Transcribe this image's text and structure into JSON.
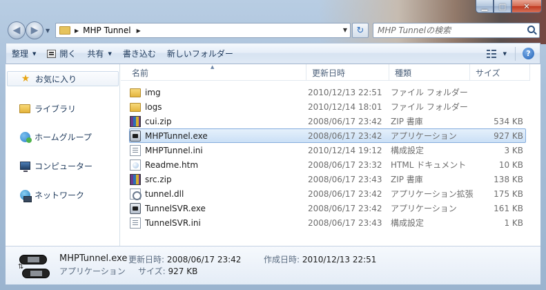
{
  "window": {
    "address_path": "MHP Tunnel",
    "search_placeholder": "MHP Tunnelの検索"
  },
  "toolbar": {
    "organize": "整理",
    "open": "開く",
    "share": "共有",
    "burn": "書き込む",
    "new_folder": "新しいフォルダー"
  },
  "nav": {
    "favorites": "お気に入り",
    "libraries": "ライブラリ",
    "homegroup": "ホームグループ",
    "computer": "コンピューター",
    "network": "ネットワーク"
  },
  "columns": {
    "name": "名前",
    "date": "更新日時",
    "type": "種類",
    "size": "サイズ"
  },
  "files": [
    {
      "name": "img",
      "date": "2010/12/13 22:51",
      "type": "ファイル フォルダー",
      "size": "",
      "icon": "folder"
    },
    {
      "name": "logs",
      "date": "2010/12/14 18:01",
      "type": "ファイル フォルダー",
      "size": "",
      "icon": "folder"
    },
    {
      "name": "cui.zip",
      "date": "2008/06/17 23:42",
      "type": "ZIP 書庫",
      "size": "534 KB",
      "icon": "zip"
    },
    {
      "name": "MHPTunnel.exe",
      "date": "2008/06/17 23:42",
      "type": "アプリケーション",
      "size": "927 KB",
      "icon": "exe"
    },
    {
      "name": "MHPTunnel.ini",
      "date": "2010/12/14 19:12",
      "type": "構成設定",
      "size": "3 KB",
      "icon": "ini"
    },
    {
      "name": "Readme.htm",
      "date": "2008/06/17 23:32",
      "type": "HTML ドキュメント",
      "size": "10 KB",
      "icon": "htm"
    },
    {
      "name": "src.zip",
      "date": "2008/06/17 23:43",
      "type": "ZIP 書庫",
      "size": "138 KB",
      "icon": "zip"
    },
    {
      "name": "tunnel.dll",
      "date": "2008/06/17 23:42",
      "type": "アプリケーション拡張",
      "size": "175 KB",
      "icon": "dll"
    },
    {
      "name": "TunnelSVR.exe",
      "date": "2008/06/17 23:42",
      "type": "アプリケーション",
      "size": "161 KB",
      "icon": "exe"
    },
    {
      "name": "TunnelSVR.ini",
      "date": "2008/06/17 23:43",
      "type": "構成設定",
      "size": "1 KB",
      "icon": "ini"
    }
  ],
  "selected_index": 3,
  "details": {
    "name": "MHPTunnel.exe",
    "type": "アプリケーション",
    "modified_label": "更新日時:",
    "modified_value": "2008/06/17 23:42",
    "created_label": "作成日時:",
    "created_value": "2010/12/13 22:51",
    "size_label": "サイズ:",
    "size_value": "927 KB"
  }
}
